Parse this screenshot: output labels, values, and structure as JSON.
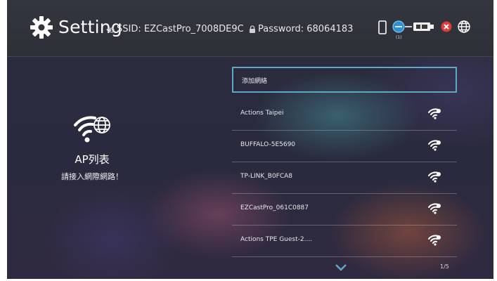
{
  "header": {
    "title": "Setting",
    "ssid": "SSID: EZCastPro_7008DE9C",
    "password": "Password: 68064183",
    "status_badge": "(1)"
  },
  "left_panel": {
    "title": "AP列表",
    "subtitle": "請接入網際網路！"
  },
  "networks": {
    "add": "添加網絡",
    "items": [
      "Actions Taipei",
      "BUFFALO-5E5690",
      "TP-LINK_B0FCA8",
      "EZCastPro_061C0887",
      "Actions TPE Guest-2...."
    ]
  },
  "pagination": "1/5",
  "colors": {
    "focus": "#5fa8c3",
    "background": "#2b2d3d",
    "close_badge": "#e23a3a"
  },
  "icons": [
    "gear-icon",
    "wifi-globe-icon",
    "chevron-down-icon",
    "wifi-signal-icon"
  ]
}
